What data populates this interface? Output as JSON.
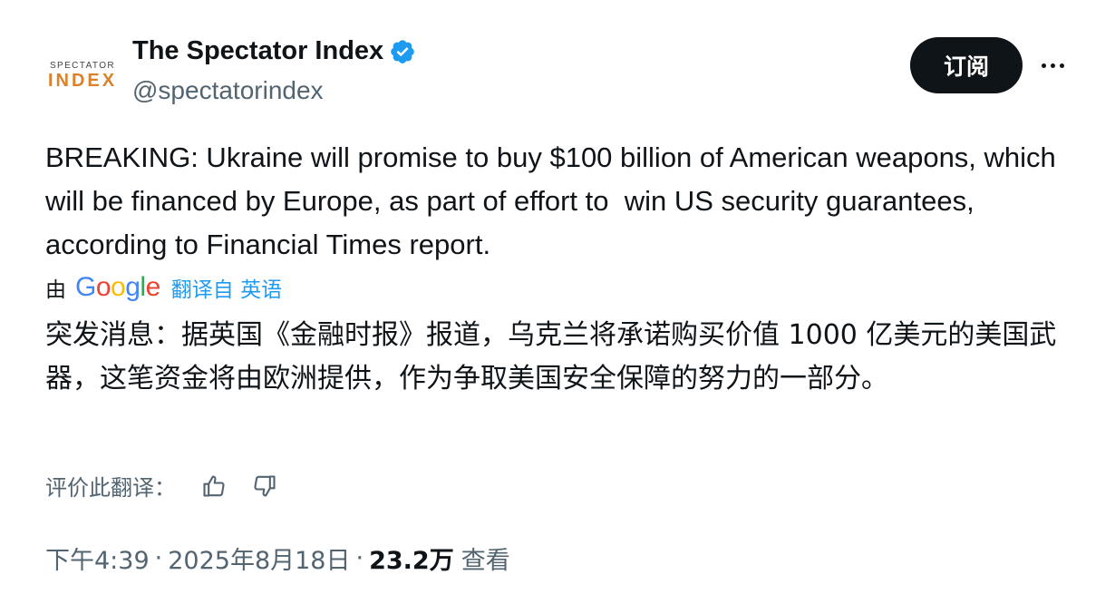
{
  "author": {
    "avatar_text_top": "SPECTATOR",
    "avatar_text_bottom": "INDEX",
    "display_name": "The Spectator Index",
    "handle": "@spectatorindex",
    "verified_icon": "verified-badge-icon",
    "verified_color": "#1d9bf0"
  },
  "actions": {
    "subscribe_label": "订阅",
    "more_icon": "more-horizontal-icon"
  },
  "tweet": {
    "text": "BREAKING: Ukraine will promise to buy $100 billion of American weapons, which will be financed by Europe, as part of effort to  win US security guarantees, according to Financial Times report."
  },
  "translation": {
    "by_label": "由",
    "provider": "Google",
    "translated_from": "翻译自 英语",
    "text": "突发消息：据英国《金融时报》报道，乌克兰将承诺购买价值 1000 亿美元的美国武器，这笔资金将由欧洲提供，作为争取美国安全保障的努力的一部分。",
    "rate_label": "评价此翻译：",
    "thumbs_up_icon": "thumbs-up-icon",
    "thumbs_down_icon": "thumbs-down-icon"
  },
  "meta": {
    "time": "下午4:39",
    "separator": "·",
    "date": "2025年8月18日",
    "views_count": "23.2万",
    "views_label": "查看"
  },
  "colors": {
    "text_primary": "#0f1419",
    "text_secondary": "#536471",
    "link": "#1d9bf0",
    "button_bg": "#0f1419",
    "avatar_accent": "#d9822b"
  }
}
